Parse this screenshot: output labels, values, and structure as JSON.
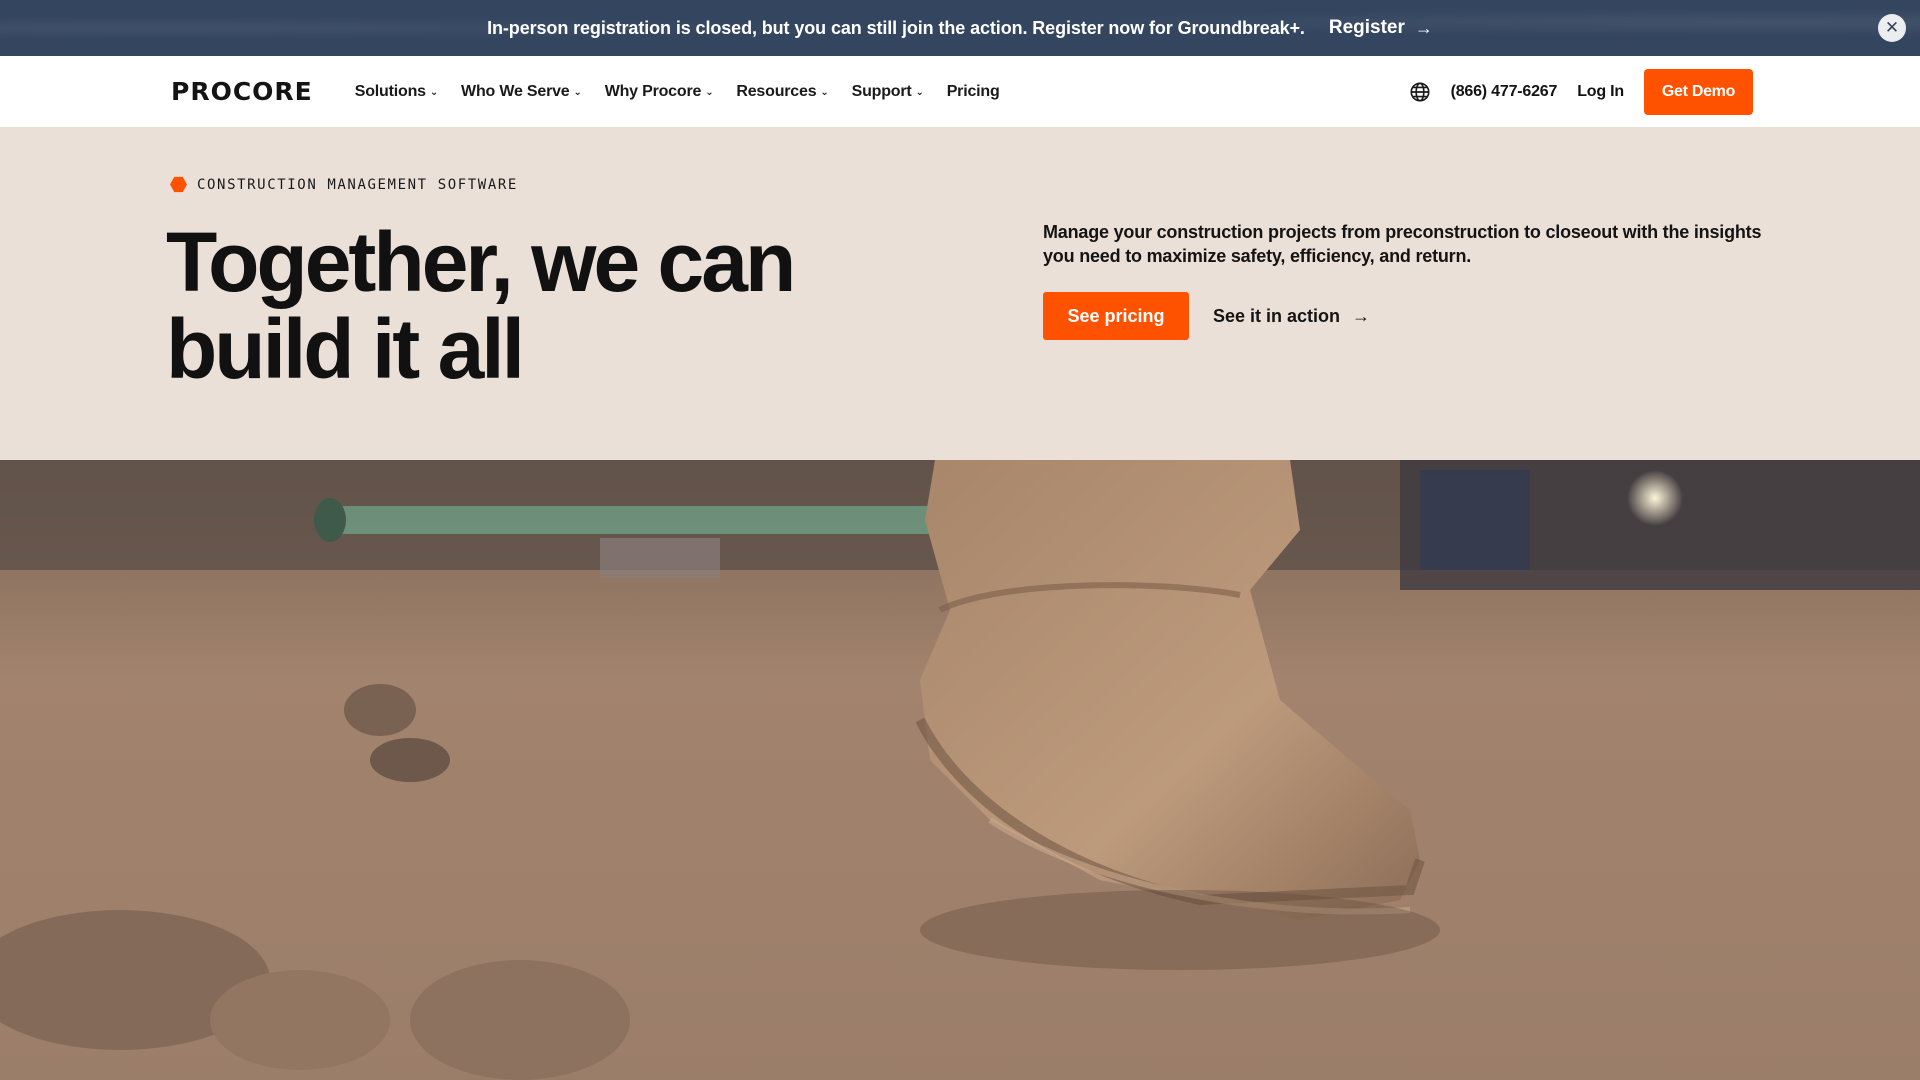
{
  "banner": {
    "text": "In-person registration is closed, but you can still join the action. Register now for Groundbreak+.",
    "link_label": "Register",
    "link_arrow": "→",
    "close_glyph": "✕"
  },
  "nav": {
    "logo": "PROCORE",
    "items": [
      {
        "label": "Solutions",
        "has_dropdown": true
      },
      {
        "label": "Who We Serve",
        "has_dropdown": true
      },
      {
        "label": "Why Procore",
        "has_dropdown": true
      },
      {
        "label": "Resources",
        "has_dropdown": true
      },
      {
        "label": "Support",
        "has_dropdown": true
      },
      {
        "label": "Pricing",
        "has_dropdown": false
      }
    ],
    "chevron": "⌄",
    "phone": "(866) 477-6267",
    "login": "Log In",
    "demo": "Get Demo"
  },
  "hero": {
    "eyebrow": "CONSTRUCTION MANAGEMENT SOFTWARE",
    "headline_line1": "Together, we can",
    "headline_line2": "build it all",
    "subtext": "Manage your construction projects from preconstruction to closeout with the insights you need to maximize safety, efficiency, and return.",
    "primary_cta": "See pricing",
    "secondary_cta": "See it in action",
    "secondary_arrow": "→"
  },
  "colors": {
    "brand_orange": "#ff5200",
    "banner_bg": "#34455f",
    "hero_bg": "#ebe0d8"
  },
  "icons": [
    "globe-icon",
    "close-icon",
    "arrow-right-icon",
    "chevron-down-icon",
    "hexagon-icon"
  ]
}
